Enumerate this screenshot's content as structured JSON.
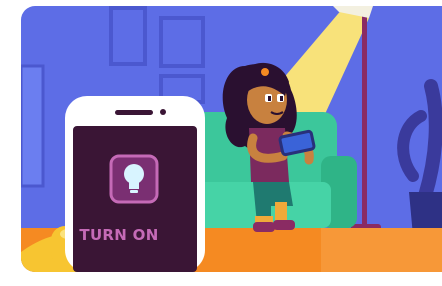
{
  "illustration": {
    "scene": "woman-on-couch-with-tablet-and-smartphone",
    "phone": {
      "button_label": "TURN ON",
      "icon": "light-bulb-icon"
    },
    "colors": {
      "wall": "#5d6de6",
      "lamp_light": "#f8e27a",
      "couch": "#3cc79b",
      "floor": "#f58a22",
      "phone_screen": "#3a1535",
      "phone_button": "#7a2f72",
      "skin": "#c8813f"
    }
  }
}
